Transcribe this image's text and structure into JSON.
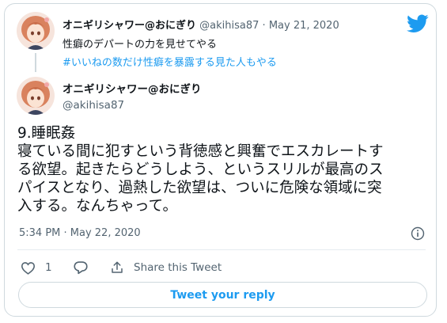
{
  "quoted": {
    "name": "オニギリシャワー@おにぎり",
    "handle": "@akihisa87",
    "separator": "·",
    "date": "May 21, 2020",
    "line1": "性癖のデパートの力を見せてやる",
    "line2": "#いいねの数だけ性癖を暴露する見た人もやる"
  },
  "tweet": {
    "name": "オニギリシャワー@おにぎり",
    "handle": "@akihisa87",
    "lines": [
      "9.睡眠姦",
      "寝ている間に犯すという背徳感と興奮でエスカレートす",
      "る欲望。起きたらどうしよう、というスリルが最高のス",
      "パイスとなり、過熱した欲望は、ついに危険な領域に突",
      "入する。なんちゃって。"
    ],
    "timestamp": "5:34 PM · May 22, 2020"
  },
  "actions": {
    "like_count": "1",
    "share_label": "Share this Tweet"
  },
  "reply_button": "Tweet your reply",
  "icons": {
    "brand": "twitter-bird-icon",
    "info": "info-icon",
    "like": "heart-icon",
    "reply": "speech-bubble-icon",
    "share": "share-icon"
  },
  "colors": {
    "accent": "#1d9bf0",
    "muted": "#536471",
    "border": "#cfd9de"
  }
}
